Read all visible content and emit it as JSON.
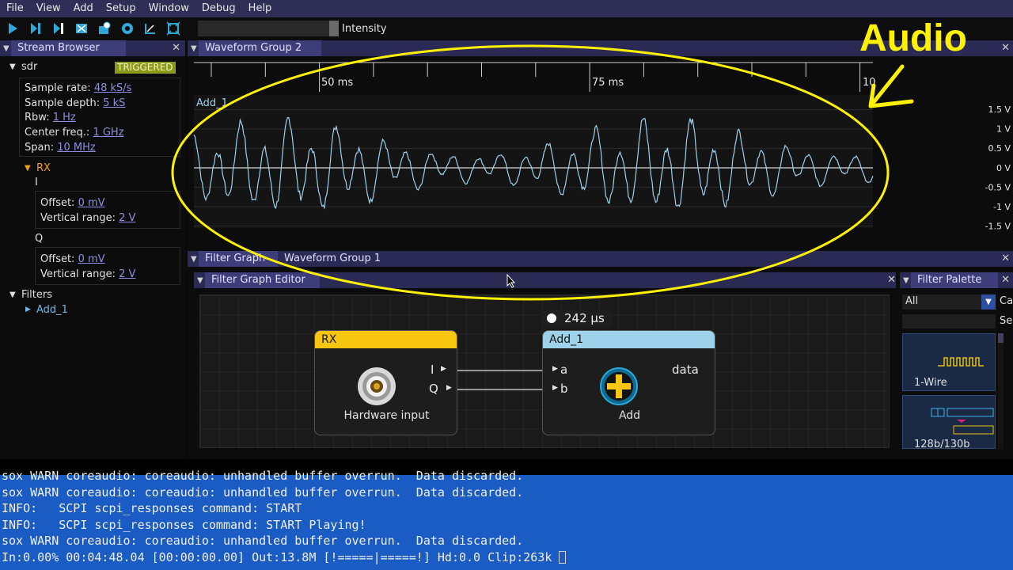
{
  "menu": [
    "File",
    "View",
    "Add",
    "Setup",
    "Window",
    "Debug",
    "Help"
  ],
  "toolbar": {
    "intensity_label": "Intensity"
  },
  "stream_browser": {
    "title": "Stream Browser",
    "device": "sdr",
    "status": "TRIGGERED",
    "props": [
      {
        "label": "Sample rate:",
        "value": "48 kS/s"
      },
      {
        "label": "Sample depth:",
        "value": "5 kS"
      },
      {
        "label": "Rbw:",
        "value": "1 Hz"
      },
      {
        "label": "Center freq.:",
        "value": "1 GHz"
      },
      {
        "label": "Span:",
        "value": "10 MHz"
      }
    ],
    "rx": "RX",
    "ch_i": "I",
    "ch_q": "Q",
    "i_offset_label": "Offset:",
    "i_offset": "0 mV",
    "i_range_label": "Vertical range:",
    "i_range": "2 V",
    "q_offset_label": "Offset:",
    "q_offset": "0 mV",
    "q_range_label": "Vertical range:",
    "q_range": "2 V",
    "filters": "Filters",
    "filter_item": "Add_1"
  },
  "waveform": {
    "tab": "Waveform Group 2",
    "ticks": [
      "50 ms",
      "75 ms",
      "10"
    ],
    "trace_label": "Add_1",
    "y_labels": [
      "1.5 V",
      "1 V",
      "0.5 V",
      "0 V",
      "-0.5 V",
      "-1 V",
      "-1.5 V"
    ]
  },
  "annotation": {
    "text": "Audio",
    "color": "#fff200"
  },
  "lower_tabs": {
    "tab1": "Filter Graph",
    "tab2": "Waveform Group 1"
  },
  "filter_graph": {
    "title": "Filter Graph Editor",
    "timing": "242 µs",
    "rx_node": {
      "title": "RX",
      "caption": "Hardware input",
      "out_i": "I",
      "out_q": "Q"
    },
    "add_node": {
      "title": "Add_1",
      "caption": "Add",
      "in_a": "a",
      "in_b": "b",
      "out": "data"
    }
  },
  "palette": {
    "title": "Filter Palette",
    "category": "All",
    "cat_label": "Ca",
    "search_label": "Se",
    "items": [
      "1-Wire",
      "128b/130b"
    ]
  },
  "console": [
    "sox WARN coreaudio: coreaudio: unhandled buffer overrun.  Data discarded.",
    "sox WARN coreaudio: coreaudio: unhandled buffer overrun.  Data discarded.",
    "INFO:   SCPI scpi_responses command: START",
    "INFO:   SCPI scpi_responses command: START Playing!",
    "sox WARN coreaudio: coreaudio: unhandled buffer overrun.  Data discarded.",
    "In:0.00% 00:04:48.04 [00:00:00.00] Out:13.8M [!=====|=====!] Hd:0.0 Clip:263k"
  ]
}
